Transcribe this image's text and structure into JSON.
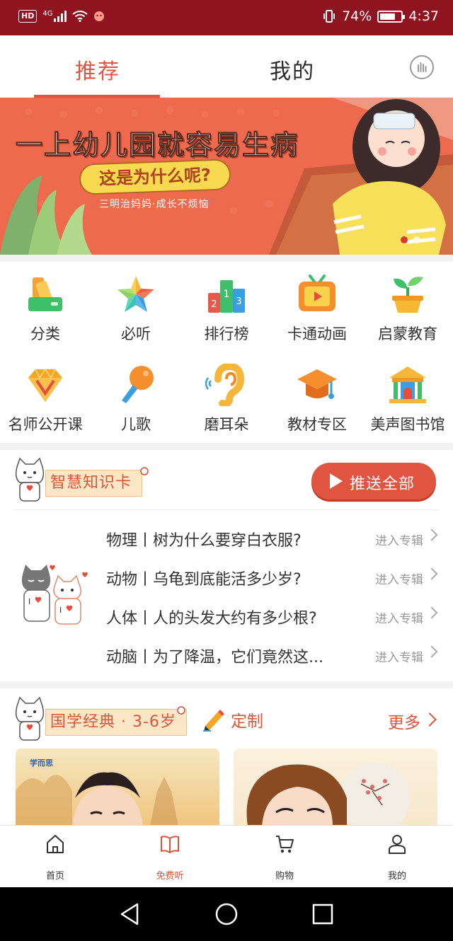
{
  "status_bar": {
    "hd": "HD",
    "network": "4G",
    "battery_text": "74%",
    "battery_level": 0.74,
    "time": "4:37"
  },
  "top_tabs": {
    "recommend": "推荐",
    "mine": "我的",
    "stats_icon": "bar-chart-circle-icon"
  },
  "banner": {
    "title": "一上幼儿园就容易生病",
    "pill": "这是为什么呢?",
    "subtitle": "三明治妈妈·成长不烦恼"
  },
  "categories": [
    {
      "label": "分类",
      "icon": "category-icon"
    },
    {
      "label": "必听",
      "icon": "star-icon"
    },
    {
      "label": "排行榜",
      "icon": "ranking-podium-icon"
    },
    {
      "label": "卡通动画",
      "icon": "tv-play-icon"
    },
    {
      "label": "启蒙教育",
      "icon": "sprout-pot-icon"
    },
    {
      "label": "名师公开课",
      "icon": "diamond-icon"
    },
    {
      "label": "儿歌",
      "icon": "microphone-icon"
    },
    {
      "label": "磨耳朵",
      "icon": "ear-icon"
    },
    {
      "label": "教材专区",
      "icon": "graduation-cap-icon"
    },
    {
      "label": "美声图书馆",
      "icon": "library-icon"
    }
  ],
  "knowledge": {
    "tag": "智慧知识卡",
    "push_all": "推送全部",
    "items": [
      {
        "title": "物理丨树为什么要穿白衣服?",
        "link": "进入专辑"
      },
      {
        "title": "动物丨乌龟到底能活多少岁?",
        "link": "进入专辑"
      },
      {
        "title": "人体丨人的头发大约有多少根?",
        "link": "进入专辑"
      },
      {
        "title": "动脑丨为了降温，它们竟然这...",
        "link": "进入专辑"
      }
    ]
  },
  "classics": {
    "tag": "国学经典 · 3-6岁",
    "customize": "定制",
    "more": "更多",
    "card_brand": "学而思"
  },
  "bottom_nav": [
    {
      "label": "首页",
      "icon": "home-icon",
      "active": false
    },
    {
      "label": "免费听",
      "icon": "book-open-icon",
      "active": true
    },
    {
      "label": "购物",
      "icon": "cart-icon",
      "active": false
    },
    {
      "label": "我的",
      "icon": "person-icon",
      "active": false
    }
  ],
  "colors": {
    "status_bar": "#8f1420",
    "accent": "#e0553f",
    "link_gray": "#999999"
  }
}
